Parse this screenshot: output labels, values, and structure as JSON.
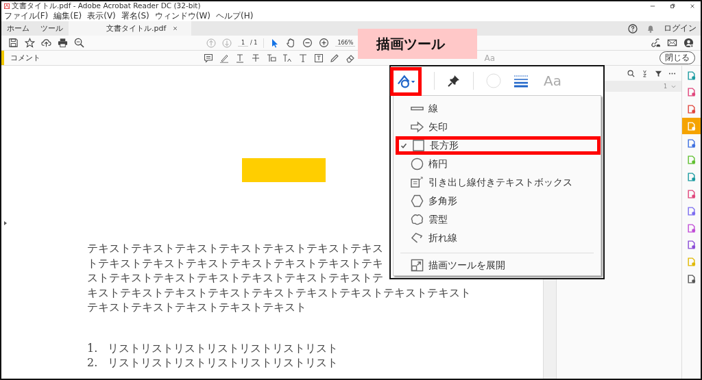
{
  "window": {
    "title": "文書タイトル.pdf - Adobe Acrobat Reader DC (32-bit)"
  },
  "menu": [
    "ファイル(F)",
    "編集(E)",
    "表示(V)",
    "署名(S)",
    "ウィンドウ(W)",
    "ヘルプ(H)"
  ],
  "tabs": [
    {
      "label": "ホーム",
      "selected": false
    },
    {
      "label": "ツール",
      "selected": false
    },
    {
      "label": "文書タイトル.pdf",
      "selected": true,
      "closable": true
    }
  ],
  "account": {
    "login": "ログイン"
  },
  "toolbar": {
    "page": "1",
    "pages": "/ 1",
    "zoom": "166%"
  },
  "comment_bar": {
    "label": "コメント",
    "font_button": "Aa",
    "close_button": "閉じる"
  },
  "callout": {
    "label": "描画ツール"
  },
  "drawing_popup": {
    "font_button": "Aa",
    "items": [
      {
        "kind": "line",
        "label": "線",
        "checked": false,
        "highlighted": false
      },
      {
        "kind": "arrow",
        "label": "矢印",
        "checked": false,
        "highlighted": false
      },
      {
        "kind": "rectangle",
        "label": "長方形",
        "checked": true,
        "highlighted": true
      },
      {
        "kind": "oval",
        "label": "楕円",
        "checked": false,
        "highlighted": false
      },
      {
        "kind": "callout",
        "label": "引き出し線付きテキストボックス",
        "checked": false,
        "highlighted": false
      },
      {
        "kind": "polygon",
        "label": "多角形",
        "checked": false,
        "highlighted": false
      },
      {
        "kind": "cloud",
        "label": "雲型",
        "checked": false,
        "highlighted": false
      },
      {
        "kind": "polyline",
        "label": "折れ線",
        "checked": false,
        "highlighted": false
      }
    ],
    "expand": "描画ツールを展開"
  },
  "comments_panel": {
    "page_count": "1"
  },
  "document": {
    "paragraph_lines": [
      "テキストテキストテキストテキストテキストテキストテキス",
      "トテキストテキストテキストテキストテキストテキストテキ",
      "ストテキストテキストテキストテキストテキストテキストテ",
      "キストテキストテキストテキストテキストテキストテキストテキストテキスト",
      "テキストテキストテキストテキストテキスト"
    ],
    "list": [
      {
        "number": "1.",
        "text": "リストリストリストリストリストリストリスト"
      },
      {
        "number": "2.",
        "text": "リストリストリストリストリストリストリスト"
      }
    ]
  },
  "tool_strip": [
    {
      "color": "#1a9aa0",
      "selected": false
    },
    {
      "color": "#e0457b",
      "selected": false
    },
    {
      "color": "#e0453b",
      "selected": false
    },
    {
      "color": "#f5a300",
      "selected": true
    },
    {
      "color": "#3d6fe0",
      "selected": false
    },
    {
      "color": "#5fbf2f",
      "selected": false
    },
    {
      "color": "#1a9aa0",
      "selected": false
    },
    {
      "color": "#e0457b",
      "selected": false
    },
    {
      "color": "#7b6cf0",
      "selected": false
    },
    {
      "color": "#c04bd6",
      "selected": false
    },
    {
      "color": "#8a4bd6",
      "selected": false
    },
    {
      "color": "#e0b800",
      "selected": false
    },
    {
      "color": "#555555",
      "selected": false
    }
  ]
}
